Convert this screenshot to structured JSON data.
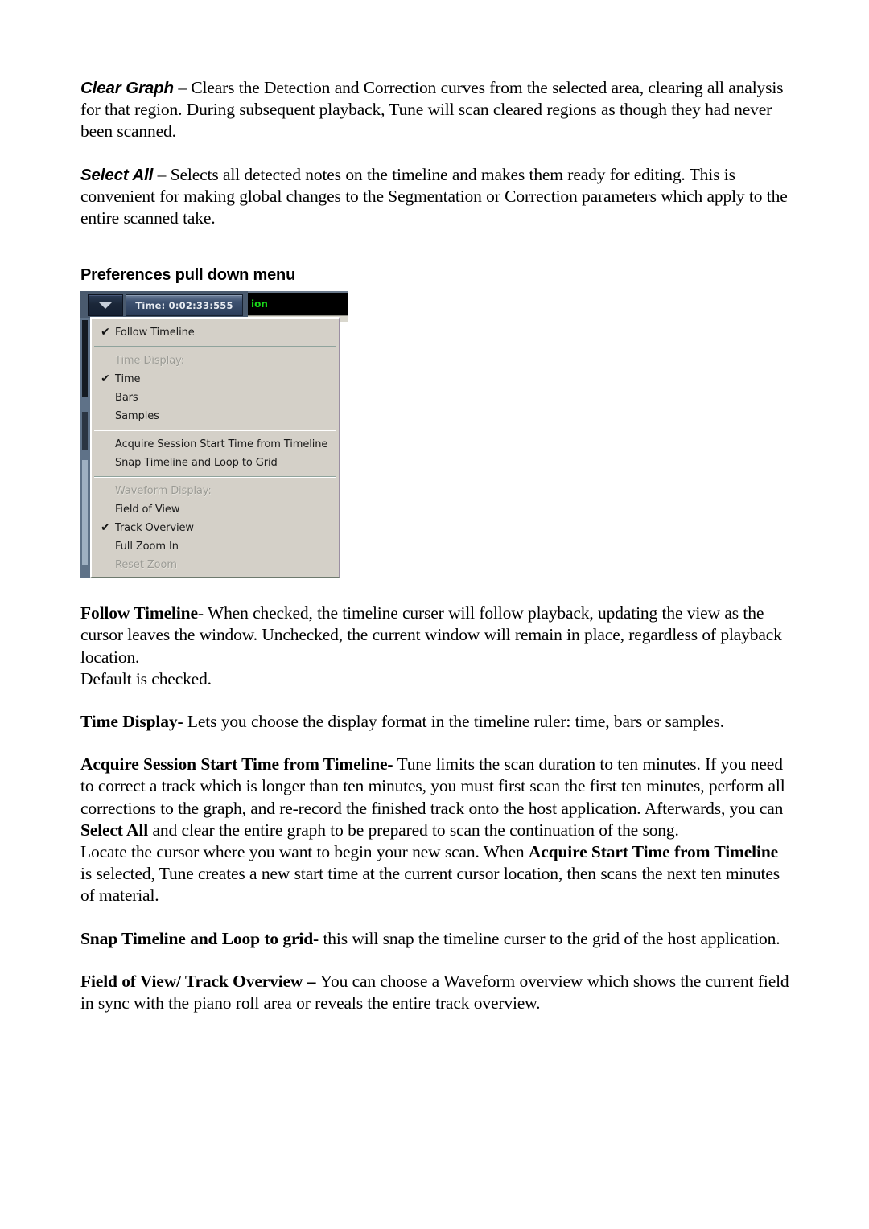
{
  "document": {
    "paragraphs": [
      {
        "id": "clear-graph",
        "lead": "Clear Graph",
        "lead_style": "italic-bold-sans",
        "dash": " – ",
        "body": "Clears the Detection and Correction curves from the selected area, clearing all analysis for that region.  During subsequent playback, Tune will scan cleared regions as though they had never been scanned."
      },
      {
        "id": "select-all",
        "lead": "Select All",
        "lead_style": "italic-bold-sans",
        "dash": " – ",
        "body": "Selects all detected notes on the timeline and makes them ready for editing. This is convenient for making global changes to the Segmentation or Correction parameters which apply to the entire scanned take."
      }
    ],
    "section_heading": "Preferences pull down menu",
    "body_after": {
      "follow_timeline": {
        "lead": "Follow Timeline-",
        "body": " When checked, the timeline curser will follow playback, updating the view as the cursor leaves the window.  Unchecked, the current window will remain in place, regardless of playback location.",
        "extra_line": "Default is checked."
      },
      "time_display": {
        "lead": "Time Display-",
        "body": " Lets you choose the display format in the timeline ruler: time, bars or samples."
      },
      "acquire": {
        "lead": "Acquire Session Start Time from Timeline-",
        "body_1": " Tune limits the scan duration to ten minutes. If you need to correct a track which is longer than ten minutes, you must first scan the first ten minutes, perform all corrections to the graph, and re-record the finished track onto the host application.  Afterwards, you can ",
        "bold_1": "Select All",
        "body_2": " and clear the entire graph to be prepared to scan the continuation of the song.",
        "body_3": "Locate the cursor where you want to begin your new scan.  When ",
        "bold_2": "Acquire Start Time from Timeline",
        "body_4": " is selected, Tune creates a new start time at the current cursor location, then scans the next ten minutes of material."
      },
      "snap": {
        "lead": "Snap Timeline and Loop to grid-",
        "body": " this will snap the timeline curser to the grid of the host application."
      },
      "field_of_view": {
        "lead": "Field of View/ Track Overview – ",
        "body": "You can choose a Waveform overview which shows the current field in sync with the piano roll area or reveals the entire track overview."
      }
    }
  },
  "screenshot": {
    "toolbar": {
      "dropdown_icon": "triangle-down-icon",
      "time_value": "Time: 0:02:33:555",
      "panel_partial_text": "ion",
      "panel_dots": "··"
    },
    "menu": {
      "items": [
        {
          "label": "Follow Timeline",
          "checked": true,
          "disabled": false,
          "separator_after": true
        },
        {
          "label": "Time Display:",
          "checked": false,
          "disabled": true,
          "separator_after": false
        },
        {
          "label": "Time",
          "checked": true,
          "disabled": false,
          "separator_after": false
        },
        {
          "label": "Bars",
          "checked": false,
          "disabled": false,
          "separator_after": false
        },
        {
          "label": "Samples",
          "checked": false,
          "disabled": false,
          "separator_after": true
        },
        {
          "label": "Acquire Session Start Time from Timeline",
          "checked": false,
          "disabled": false,
          "separator_after": false
        },
        {
          "label": "Snap Timeline and Loop to Grid",
          "checked": false,
          "disabled": false,
          "separator_after": true
        },
        {
          "label": "Waveform Display:",
          "checked": false,
          "disabled": true,
          "separator_after": false
        },
        {
          "label": "Field of View",
          "checked": false,
          "disabled": false,
          "separator_after": false
        },
        {
          "label": "Track Overview",
          "checked": true,
          "disabled": false,
          "separator_after": false
        },
        {
          "label": "Full Zoom In",
          "checked": false,
          "disabled": false,
          "separator_after": false
        },
        {
          "label": "Reset Zoom",
          "checked": false,
          "disabled": true,
          "separator_after": false
        }
      ],
      "check_glyph": "✔"
    },
    "colors": {
      "menu_bg": "#d4d0c8",
      "menu_separator": "#8fa39c",
      "disabled_text": "#9a9a94",
      "toolbar_dark": "#1b2738",
      "panel_black": "#000000",
      "panel_green_text": "#19d619"
    }
  }
}
